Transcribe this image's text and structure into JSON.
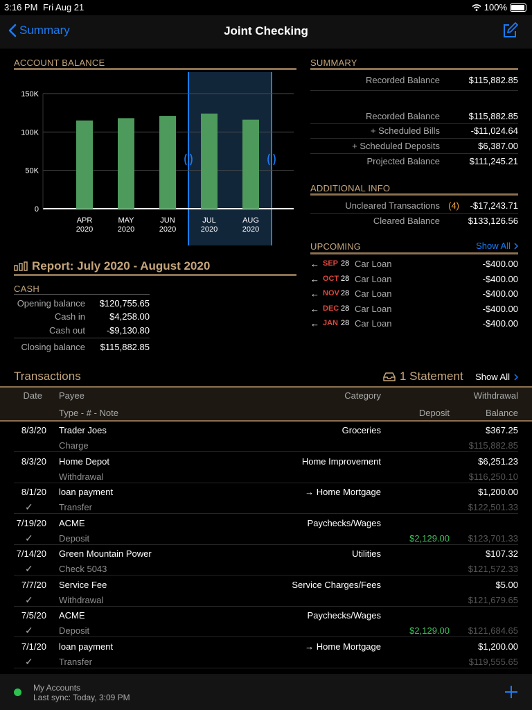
{
  "status": {
    "time": "3:16 PM",
    "date": "Fri Aug 21",
    "battery": "100%"
  },
  "nav": {
    "back_label": "Summary",
    "title": "Joint Checking"
  },
  "account_balance": {
    "header": "ACCOUNT BALANCE",
    "chart_data": {
      "type": "bar",
      "categories": [
        "APR 2020",
        "MAY 2020",
        "JUN 2020",
        "JUL 2020",
        "AUG 2020"
      ],
      "category_lines": [
        [
          "APR",
          "2020"
        ],
        [
          "MAY",
          "2020"
        ],
        [
          "JUN",
          "2020"
        ],
        [
          "JUL",
          "2020"
        ],
        [
          "AUG",
          "2020"
        ]
      ],
      "values": [
        115000,
        118000,
        121000,
        124000,
        116000
      ],
      "y_ticks": [
        {
          "v": 150000,
          "l": "150K"
        },
        {
          "v": 100000,
          "l": "100K"
        },
        {
          "v": 50000,
          "l": "50K"
        },
        {
          "v": 0,
          "l": "0"
        }
      ],
      "ylim": [
        0,
        150000
      ],
      "selected_range": [
        "JUL 2020",
        "AUG 2020"
      ],
      "bar_color": "#4e9a5c",
      "selection_color": "#1a7cf5"
    }
  },
  "report": {
    "title": "Report: July 2020 - August 2020"
  },
  "cash": {
    "header": "CASH",
    "rows": [
      {
        "label": "Opening balance",
        "value": "$120,755.65"
      },
      {
        "label": "Cash in",
        "value": "$4,258.00"
      },
      {
        "label": "Cash out",
        "value": "-$9,130.80"
      },
      {
        "label": "Closing balance",
        "value": "$115,882.85"
      }
    ]
  },
  "summary": {
    "header": "SUMMARY",
    "recorded_top": {
      "label": "Recorded Balance",
      "value": "$115,882.85"
    },
    "rows": [
      {
        "label": "Recorded Balance",
        "value": "$115,882.85"
      },
      {
        "label": "+ Scheduled Bills",
        "value": "-$11,024.64"
      },
      {
        "label": "+ Scheduled Deposits",
        "value": "$6,387.00"
      },
      {
        "label": "Projected Balance",
        "value": "$111,245.21"
      }
    ]
  },
  "additional": {
    "header": "ADDITIONAL INFO",
    "uncleared_label": "Uncleared Transactions",
    "uncleared_count": "(4)",
    "uncleared_value": "-$17,243.71",
    "cleared_label": "Cleared Balance",
    "cleared_value": "$133,126.56"
  },
  "upcoming": {
    "header": "UPCOMING",
    "show_all": "Show All",
    "items": [
      {
        "month": "SEP",
        "day": "28",
        "payee": "Car Loan",
        "amount": "-$400.00"
      },
      {
        "month": "OCT",
        "day": "28",
        "payee": "Car Loan",
        "amount": "-$400.00"
      },
      {
        "month": "NOV",
        "day": "28",
        "payee": "Car Loan",
        "amount": "-$400.00"
      },
      {
        "month": "DEC",
        "day": "28",
        "payee": "Car Loan",
        "amount": "-$400.00"
      },
      {
        "month": "JAN",
        "day": "28",
        "payee": "Car Loan",
        "amount": "-$400.00"
      }
    ]
  },
  "transactions": {
    "title": "Transactions",
    "statement_label": "1 Statement",
    "show_all": "Show All",
    "columns": {
      "date": "Date",
      "payee": "Payee",
      "category": "Category",
      "withdrawal": "Withdrawal",
      "type_note": "Type - # - Note",
      "deposit": "Deposit",
      "balance": "Balance"
    },
    "rows": [
      {
        "date": "8/3/20",
        "cleared": false,
        "payee": "Trader Joes",
        "type": "Charge",
        "category": "Groceries",
        "amount": "$367.25",
        "deposit": "",
        "balance": "$115,882.85"
      },
      {
        "date": "8/3/20",
        "cleared": false,
        "payee": "Home Depot",
        "type": "Withdrawal",
        "category": "Home Improvement",
        "amount": "$6,251.23",
        "deposit": "",
        "balance": "$116,250.10"
      },
      {
        "date": "8/1/20",
        "cleared": true,
        "payee": "loan payment",
        "type": "Transfer",
        "category": "→ Home Mortgage",
        "amount": "$1,200.00",
        "deposit": "",
        "balance": "$122,501.33"
      },
      {
        "date": "7/19/20",
        "cleared": true,
        "payee": "ACME",
        "type": "Deposit",
        "category": "Paychecks/Wages",
        "amount": "",
        "deposit": "$2,129.00",
        "balance": "$123,701.33"
      },
      {
        "date": "7/14/20",
        "cleared": true,
        "payee": "Green Mountain Power",
        "type": "Check 5043",
        "category": "Utilities",
        "amount": "$107.32",
        "deposit": "",
        "balance": "$121,572.33"
      },
      {
        "date": "7/7/20",
        "cleared": true,
        "payee": "Service Fee",
        "type": "Withdrawal",
        "category": "Service Charges/Fees",
        "amount": "$5.00",
        "deposit": "",
        "balance": "$121,679.65"
      },
      {
        "date": "7/5/20",
        "cleared": true,
        "payee": "ACME",
        "type": "Deposit",
        "category": "Paychecks/Wages",
        "amount": "",
        "deposit": "$2,129.00",
        "balance": "$121,684.65"
      },
      {
        "date": "7/1/20",
        "cleared": true,
        "payee": "loan payment",
        "type": "Transfer",
        "category": "→ Home Mortgage",
        "amount": "$1,200.00",
        "deposit": "",
        "balance": "$119,555.65"
      }
    ]
  },
  "footer": {
    "accounts_label": "My Accounts",
    "sync_label": "Last sync: Today, 3:09 PM"
  }
}
